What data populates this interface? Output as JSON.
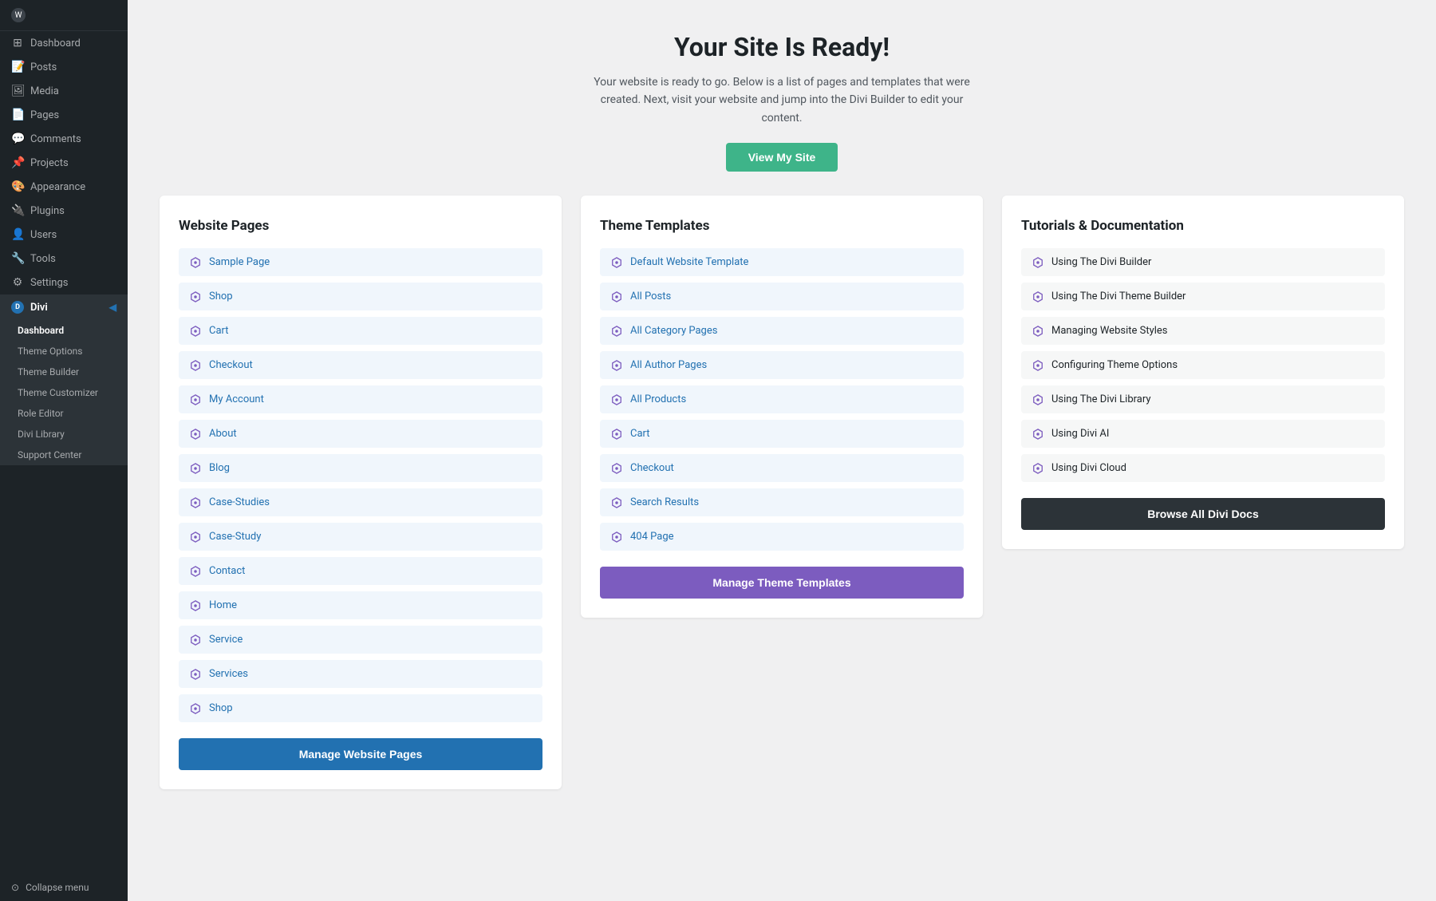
{
  "sidebar": {
    "items": [
      {
        "id": "dashboard",
        "label": "Dashboard",
        "icon": "⊞"
      },
      {
        "id": "posts",
        "label": "Posts",
        "icon": "📝"
      },
      {
        "id": "media",
        "label": "Media",
        "icon": "🖼"
      },
      {
        "id": "pages",
        "label": "Pages",
        "icon": "📄"
      },
      {
        "id": "comments",
        "label": "Comments",
        "icon": "💬"
      },
      {
        "id": "projects",
        "label": "Projects",
        "icon": "📌"
      },
      {
        "id": "appearance",
        "label": "Appearance",
        "icon": "🎨"
      },
      {
        "id": "plugins",
        "label": "Plugins",
        "icon": "🔌"
      },
      {
        "id": "users",
        "label": "Users",
        "icon": "👤"
      },
      {
        "id": "tools",
        "label": "Tools",
        "icon": "🔧"
      },
      {
        "id": "settings",
        "label": "Settings",
        "icon": "⚙"
      }
    ],
    "divi_section": {
      "label": "Divi",
      "arrow": "◀",
      "sub_items": [
        {
          "id": "dashboard",
          "label": "Dashboard",
          "active": true
        },
        {
          "id": "theme-options",
          "label": "Theme Options"
        },
        {
          "id": "theme-builder",
          "label": "Theme Builder"
        },
        {
          "id": "theme-customizer",
          "label": "Theme Customizer"
        },
        {
          "id": "role-editor",
          "label": "Role Editor"
        },
        {
          "id": "divi-library",
          "label": "Divi Library"
        },
        {
          "id": "support-center",
          "label": "Support Center"
        }
      ]
    },
    "collapse_label": "Collapse menu"
  },
  "main": {
    "title": "Your Site Is Ready!",
    "subtitle": "Your website is ready to go. Below is a list of pages and templates that were created. Next, visit your website and jump into the Divi Builder to edit your content.",
    "view_site_btn": "View My Site",
    "website_pages_card": {
      "title": "Website Pages",
      "items": [
        "Sample Page",
        "Shop",
        "Cart",
        "Checkout",
        "My Account",
        "About",
        "Blog",
        "Case-Studies",
        "Case-Study",
        "Contact",
        "Home",
        "Service",
        "Services",
        "Shop"
      ],
      "btn_label": "Manage Website Pages"
    },
    "theme_templates_card": {
      "title": "Theme Templates",
      "items": [
        "Default Website Template",
        "All Posts",
        "All Category Pages",
        "All Author Pages",
        "All Products",
        "Cart",
        "Checkout",
        "Search Results",
        "404 Page"
      ],
      "btn_label": "Manage Theme Templates"
    },
    "tutorials_card": {
      "title": "Tutorials & Documentation",
      "items": [
        "Using The Divi Builder",
        "Using The Divi Theme Builder",
        "Managing Website Styles",
        "Configuring Theme Options",
        "Using The Divi Library",
        "Using Divi AI",
        "Using Divi Cloud"
      ],
      "btn_label": "Browse All Divi Docs"
    }
  }
}
